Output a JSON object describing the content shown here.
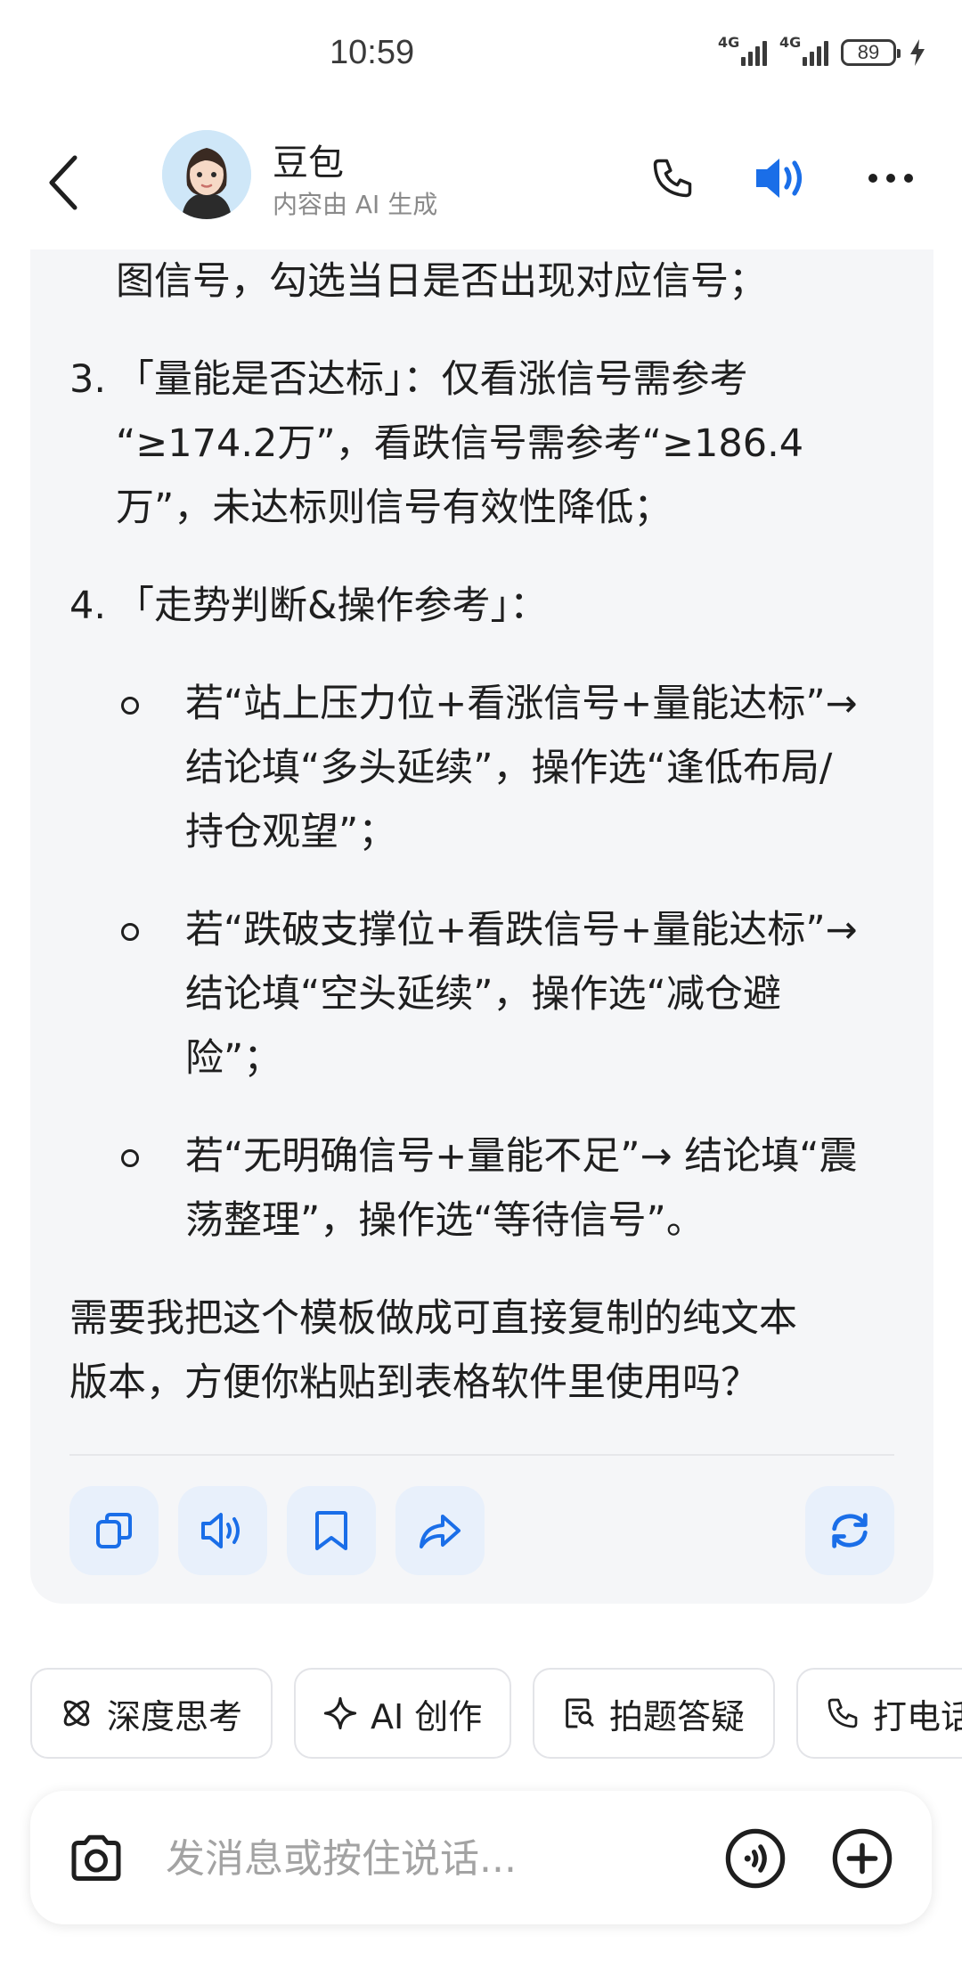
{
  "status": {
    "time": "10:59",
    "network_1": "4G",
    "network_2": "4G",
    "battery": "89"
  },
  "header": {
    "name": "豆包",
    "subtitle": "内容由 AI 生成"
  },
  "message": {
    "l1": "图信号，勾选当日是否出现对应信号；",
    "item3_num": "3.",
    "item3_l1": "「量能是否达标」：仅看涨信号需参考",
    "item3_l2": "“≥174.2万”，看跌信号需参考“≥186.4",
    "item3_l3": "万”，未达标则信号有效性降低；",
    "item4_num": "4.",
    "item4_l1": "「走势判断&操作参考」：",
    "b1_l1": "若“站上压力位+看涨信号+量能达标”→",
    "b1_l2": "结论填“多头延续”，操作选“逢低布局/",
    "b1_l3": "持仓观望”；",
    "b2_l1": "若“跌破支撑位+看跌信号+量能达标”→",
    "b2_l2": "结论填“空头延续”，操作选“减仓避",
    "b2_l3": "险”；",
    "b3_l1": "若“无明确信号+量能不足”→ 结论填“震",
    "b3_l2": "荡整理”，操作选“等待信号”。",
    "closing_l1": "需要我把这个模板做成可直接复制的纯文本",
    "closing_l2": "版本，方便你粘贴到表格软件里使用吗？"
  },
  "actions": {
    "icons": [
      "copy-icon",
      "speaker-icon",
      "bookmark-icon",
      "share-icon",
      "refresh-icon"
    ]
  },
  "chips": [
    {
      "label": "深度思考",
      "icon": "atom-icon"
    },
    {
      "label": "AI 创作",
      "icon": "sparkle-icon"
    },
    {
      "label": "拍题答疑",
      "icon": "scan-icon"
    },
    {
      "label": "打电话",
      "icon": "phone-icon"
    }
  ],
  "input": {
    "placeholder": "发消息或按住说话..."
  },
  "colors": {
    "accent": "#1a6ee8",
    "card_bg": "#f5f6f8",
    "action_bg": "#e8f0fb"
  }
}
